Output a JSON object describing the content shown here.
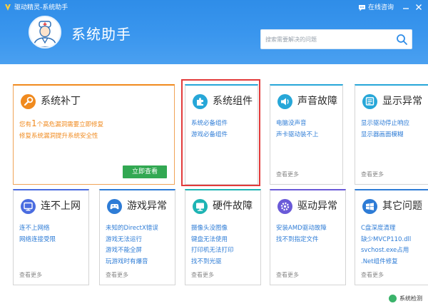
{
  "titlebar": {
    "app_title": "驱动精灵-系统助手",
    "consult_label": "在线咨询"
  },
  "header": {
    "title": "系统助手"
  },
  "search": {
    "placeholder": "搜索需要解决的问题"
  },
  "colors": {
    "header_blue": "#3a96ee",
    "accent_orange": "#f08a1e",
    "link_blue": "#2e7cd6",
    "selected_red": "#e23a3a",
    "button_green": "#32a852"
  },
  "cards": [
    {
      "id": "patch",
      "title": "系统补丁",
      "icon": "wrench-icon",
      "alert": {
        "prefix": "您有",
        "count": "1",
        "suffix": "个高危漏洞需要立即修复"
      },
      "links": [
        "修复系统漏洞提升系统安全性"
      ],
      "button": "立即查看"
    },
    {
      "id": "components",
      "title": "系统组件",
      "icon": "puzzle-icon",
      "links": [
        "系统必备组件",
        "游戏必备组件"
      ],
      "more": ""
    },
    {
      "id": "sound",
      "title": "声音故障",
      "icon": "speaker-icon",
      "links": [
        "电脑没声音",
        "声卡驱动装不上"
      ],
      "more": "查看更多"
    },
    {
      "id": "display",
      "title": "显示异常",
      "icon": "monitor-icon",
      "links": [
        "显示驱动停止响应",
        "显示器画面模糊"
      ],
      "more": "查看更多"
    },
    {
      "id": "network",
      "title": "连不上网",
      "icon": "computer-icon",
      "links": [
        "连不上网络",
        "网络连接受限"
      ],
      "more": "查看更多"
    },
    {
      "id": "game",
      "title": "游戏异常",
      "icon": "gamepad-icon",
      "links": [
        "未知的DirectX错误",
        "游戏无法运行",
        "游戏不能全屏",
        "玩游戏时有爆音"
      ],
      "more": "查看更多"
    },
    {
      "id": "hardware",
      "title": "硬件故障",
      "icon": "display-icon",
      "links": [
        "摄像头没图像",
        "键盘无法使用",
        "打印机无法打印",
        "找不到光驱"
      ],
      "more": "查看更多"
    },
    {
      "id": "driver",
      "title": "驱动异常",
      "icon": "gear-icon",
      "links": [
        "安装AMD驱动故障",
        "找不到指定文件"
      ],
      "more": "查看更多"
    },
    {
      "id": "other",
      "title": "其它问题",
      "icon": "windows-icon",
      "links": [
        "C盘深度清理",
        "缺少MVCP110.dll",
        "svchost.exe占用",
        ".Net组件修复"
      ],
      "more": "查看更多"
    }
  ],
  "footer": {
    "status": "系统检测"
  }
}
